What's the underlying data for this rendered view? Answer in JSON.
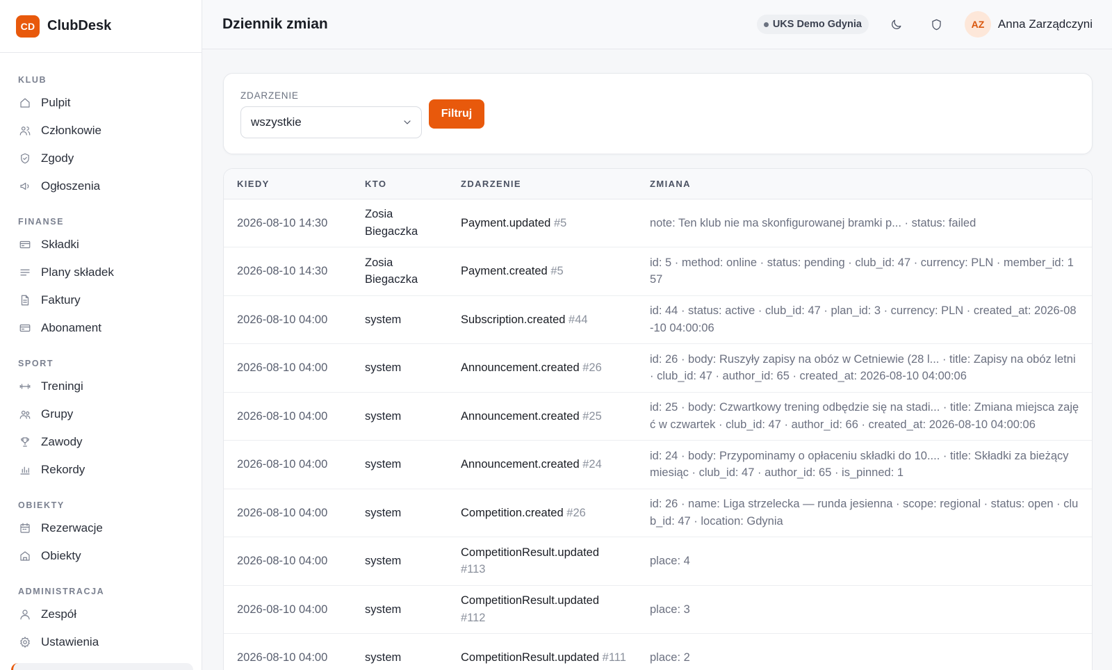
{
  "brand": {
    "logo": "CD",
    "name": "ClubDesk"
  },
  "sidebar": {
    "sections": [
      {
        "title": "KLUB",
        "items": [
          {
            "label": "Pulpit",
            "icon": "home-icon"
          },
          {
            "label": "Członkowie",
            "icon": "users-icon"
          },
          {
            "label": "Zgody",
            "icon": "shield-check-icon"
          },
          {
            "label": "Ogłoszenia",
            "icon": "megaphone-icon"
          }
        ]
      },
      {
        "title": "FINANSE",
        "items": [
          {
            "label": "Składki",
            "icon": "card-icon"
          },
          {
            "label": "Plany składek",
            "icon": "list-icon"
          },
          {
            "label": "Faktury",
            "icon": "document-icon"
          },
          {
            "label": "Abonament",
            "icon": "card-icon"
          }
        ]
      },
      {
        "title": "SPORT",
        "items": [
          {
            "label": "Treningi",
            "icon": "dumbbell-icon"
          },
          {
            "label": "Grupy",
            "icon": "group-icon"
          },
          {
            "label": "Zawody",
            "icon": "trophy-icon"
          },
          {
            "label": "Rekordy",
            "icon": "bar-chart-icon"
          }
        ]
      },
      {
        "title": "OBIEKTY",
        "items": [
          {
            "label": "Rezerwacje",
            "icon": "calendar-icon"
          },
          {
            "label": "Obiekty",
            "icon": "building-icon"
          }
        ]
      },
      {
        "title": "ADMINISTRACJA",
        "items": [
          {
            "label": "Zespół",
            "icon": "user-icon"
          },
          {
            "label": "Ustawienia",
            "icon": "gear-icon"
          }
        ]
      }
    ]
  },
  "header": {
    "title": "Dziennik zmian",
    "club": "UKS Demo Gdynia",
    "avatar": "AZ",
    "user": "Anna Zarządczyni"
  },
  "filter": {
    "label": "ZDARZENIE",
    "selected": "wszystkie",
    "button": "Filtruj"
  },
  "table": {
    "columns": [
      "KIEDY",
      "KTO",
      "ZDARZENIE",
      "ZMIANA"
    ],
    "rows": [
      {
        "when": "2026-08-10 14:30",
        "who": "Zosia Biegaczka",
        "event": "Payment.updated",
        "ref": "#5",
        "change": "note: Ten klub nie ma skonfigurowanej bramki p... · status: failed"
      },
      {
        "when": "2026-08-10 14:30",
        "who": "Zosia Biegaczka",
        "event": "Payment.created",
        "ref": "#5",
        "change": "id: 5 · method: online · status: pending · club_id: 47 · currency: PLN · member_id: 157"
      },
      {
        "when": "2026-08-10 04:00",
        "who": "system",
        "event": "Subscription.created",
        "ref": "#44",
        "change": "id: 44 · status: active · club_id: 47 · plan_id: 3 · currency: PLN · created_at: 2026-08-10 04:00:06"
      },
      {
        "when": "2026-08-10 04:00",
        "who": "system",
        "event": "Announcement.created",
        "ref": "#26",
        "change": "id: 26 · body: Ruszyły zapisy na obóz w Cetniewie (28 l... · title: Zapisy na obóz letni · club_id: 47 · author_id: 65 · created_at: 2026-08-10 04:00:06"
      },
      {
        "when": "2026-08-10 04:00",
        "who": "system",
        "event": "Announcement.created",
        "ref": "#25",
        "change": "id: 25 · body: Czwartkowy trening odbędzie się na stadi... · title: Zmiana miejsca zajęć w czwartek · club_id: 47 · author_id: 66 · created_at: 2026-08-10 04:00:06"
      },
      {
        "when": "2026-08-10 04:00",
        "who": "system",
        "event": "Announcement.created",
        "ref": "#24",
        "change": "id: 24 · body: Przypominamy o opłaceniu składki do 10.... · title: Składki za bieżący miesiąc · club_id: 47 · author_id: 65 · is_pinned: 1"
      },
      {
        "when": "2026-08-10 04:00",
        "who": "system",
        "event": "Competition.created",
        "ref": "#26",
        "change": "id: 26 · name: Liga strzelecka — runda jesienna · scope: regional · status: open · club_id: 47 · location: Gdynia"
      },
      {
        "when": "2026-08-10 04:00",
        "who": "system",
        "event": "CompetitionResult.updated",
        "ref": "#113",
        "change": "place: 4"
      },
      {
        "when": "2026-08-10 04:00",
        "who": "system",
        "event": "CompetitionResult.updated",
        "ref": "#112",
        "change": "place: 3"
      },
      {
        "when": "2026-08-10 04:00",
        "who": "system",
        "event": "CompetitionResult.updated",
        "ref": "#111",
        "change": "place: 2"
      }
    ]
  },
  "colors": {
    "accent": "#e8590c",
    "sidebar_bg": "#ffffff",
    "page_bg": "#f6f7f9"
  }
}
